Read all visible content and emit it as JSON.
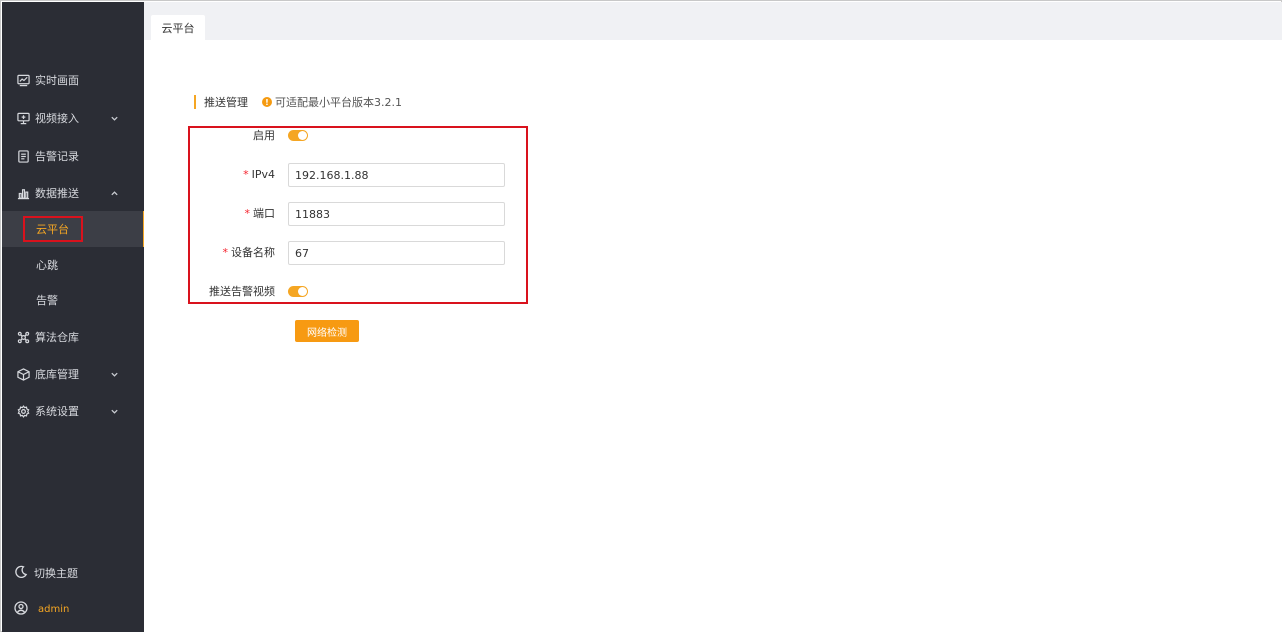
{
  "sidebar": {
    "items": [
      {
        "label": "实时画面",
        "icon": "chart-line-icon"
      },
      {
        "label": "视频接入",
        "icon": "monitor-icon",
        "expanded": false
      },
      {
        "label": "告警记录",
        "icon": "document-icon"
      },
      {
        "label": "数据推送",
        "icon": "bar-chart-icon",
        "expanded": true
      },
      {
        "label": "算法仓库",
        "icon": "cluster-icon"
      },
      {
        "label": "底库管理",
        "icon": "cube-icon",
        "expanded": false
      },
      {
        "label": "系统设置",
        "icon": "gear-icon",
        "expanded": false
      }
    ],
    "sub_items": [
      {
        "label": "云平台",
        "active": true
      },
      {
        "label": "心跳"
      },
      {
        "label": "告警"
      }
    ],
    "theme_label": "切换主题",
    "user": "admin"
  },
  "tabs": [
    {
      "label": "云平台"
    }
  ],
  "section": {
    "title": "推送管理",
    "hint": "可适配最小平台版本3.2.1"
  },
  "form": {
    "enable_label": "启用",
    "enable_on": true,
    "ipv4_label": "IPv4",
    "ipv4_value": "192.168.1.88",
    "port_label": "端口",
    "port_value": "11883",
    "device_label": "设备名称",
    "device_value": "67",
    "push_video_label": "推送告警视频",
    "push_video_on": true,
    "required_mark": "*"
  },
  "check_button": "网络检测",
  "colors": {
    "accent": "#f5a623",
    "sidebar_bg": "#2b2d35",
    "highlight_box": "#d9121d"
  }
}
